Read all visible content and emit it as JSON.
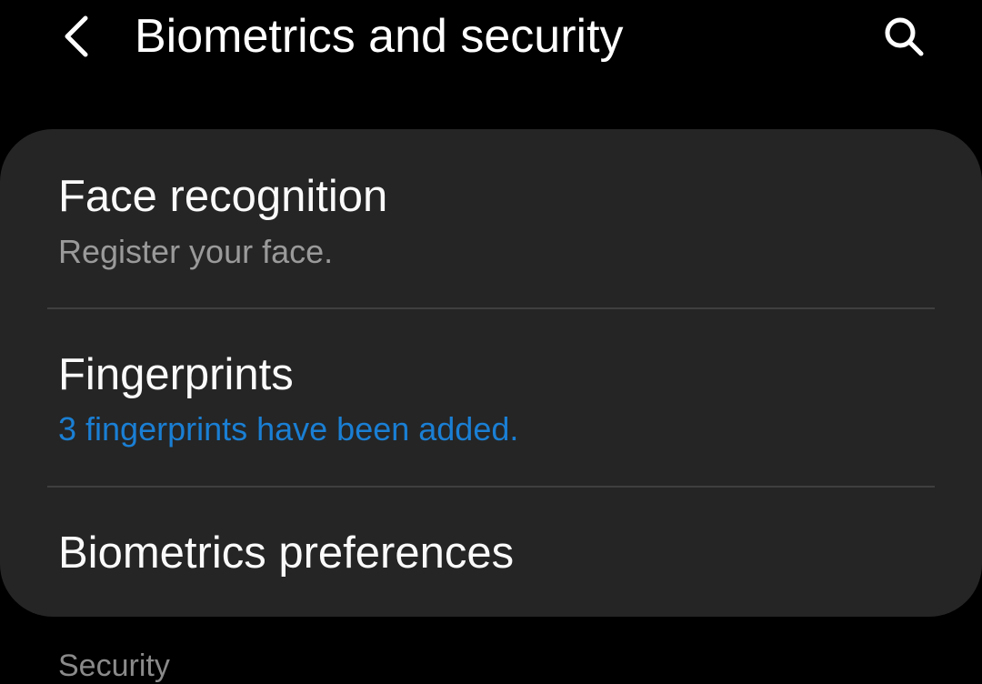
{
  "header": {
    "title": "Biometrics and security",
    "back_icon": "chevron-left-icon",
    "search_icon": "search-icon"
  },
  "card": {
    "items": [
      {
        "title": "Face recognition",
        "subtitle": "Register your face."
      },
      {
        "title": "Fingerprints",
        "subtitle": "3 fingerprints have been added."
      },
      {
        "title": "Biometrics preferences"
      }
    ]
  },
  "section": {
    "label": "Security"
  },
  "colors": {
    "background": "#000000",
    "card": "#252525",
    "divider": "#3f3f3f",
    "text_primary": "#fafafa",
    "text_secondary": "#9a9a9a",
    "accent": "#1a7fd4"
  }
}
